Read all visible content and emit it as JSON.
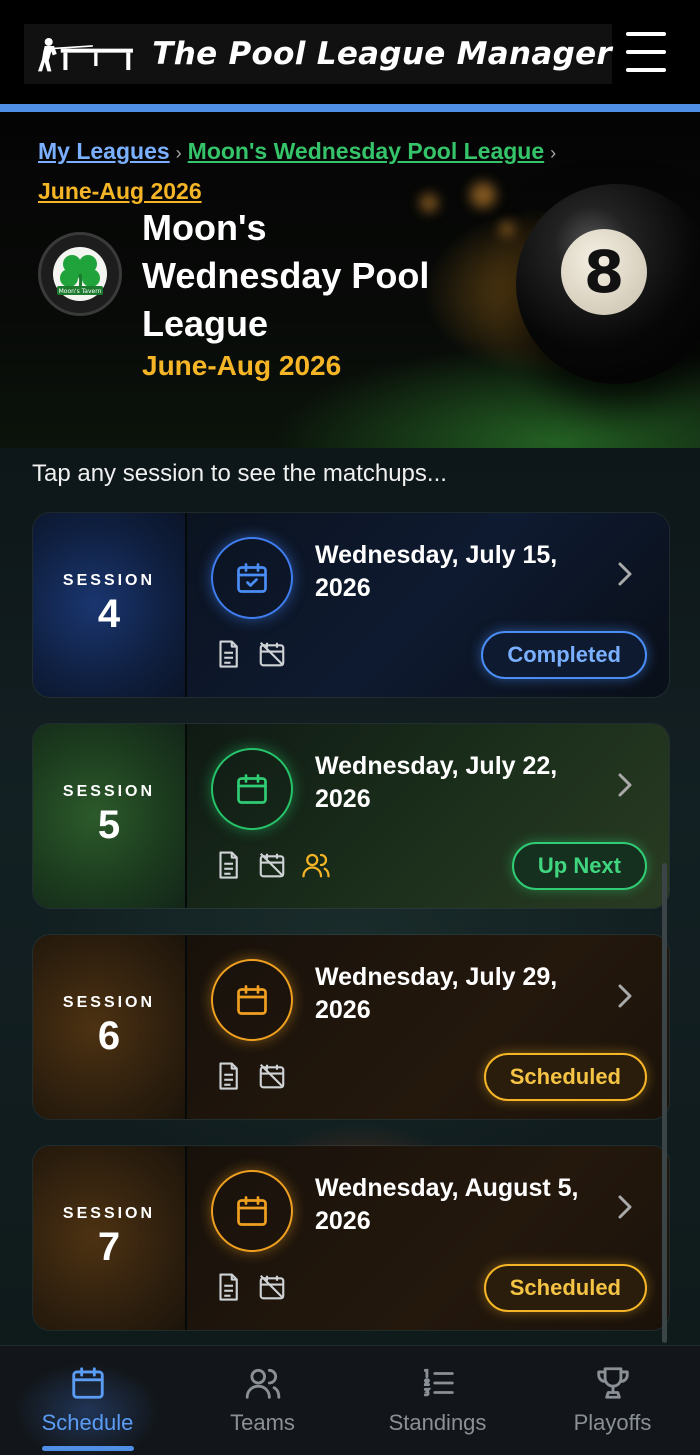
{
  "header": {
    "app_title": "The Pool League Manager",
    "menu_icon": "hamburger-menu-icon"
  },
  "breadcrumb": {
    "items": [
      "My Leagues",
      "Moon's Wednesday Pool League",
      "June-Aug 2026"
    ]
  },
  "league": {
    "name": "Moon's Wednesday Pool League",
    "season": "June-Aug 2026",
    "logo_text": "Moon's Tavern"
  },
  "hero": {
    "ball_number": "8"
  },
  "hint": "Tap any session to see the matchups...",
  "sessions": [
    {
      "label": "SESSION",
      "number": "4",
      "date": "Wednesday, July 15, 2026",
      "status": "Completed",
      "theme_color": "#4a8df5",
      "icons": [
        "document-icon",
        "calendar-off-icon"
      ]
    },
    {
      "label": "SESSION",
      "number": "5",
      "date": "Wednesday, July 22, 2026",
      "status": "Up Next",
      "theme_color": "#2fcc74",
      "icons": [
        "document-icon",
        "calendar-off-icon",
        "users-icon"
      ]
    },
    {
      "label": "SESSION",
      "number": "6",
      "date": "Wednesday, July 29, 2026",
      "status": "Scheduled",
      "theme_color": "#f5b526",
      "icons": [
        "document-icon",
        "calendar-off-icon"
      ]
    },
    {
      "label": "SESSION",
      "number": "7",
      "date": "Wednesday, August 5, 2026",
      "status": "Scheduled",
      "theme_color": "#f5b526",
      "icons": [
        "document-icon",
        "calendar-off-icon"
      ]
    }
  ],
  "bottom_nav": {
    "items": [
      {
        "label": "Schedule",
        "icon": "calendar-icon",
        "active": true
      },
      {
        "label": "Teams",
        "icon": "users-icon",
        "active": false
      },
      {
        "label": "Standings",
        "icon": "list-ordered-icon",
        "active": false
      },
      {
        "label": "Playoffs",
        "icon": "trophy-icon",
        "active": false
      }
    ]
  },
  "colors": {
    "accent_blue": "#4f8fe6",
    "link_blue": "#7ab0ff",
    "link_green": "#35c46a",
    "highlight_gold": "#f5b526"
  }
}
